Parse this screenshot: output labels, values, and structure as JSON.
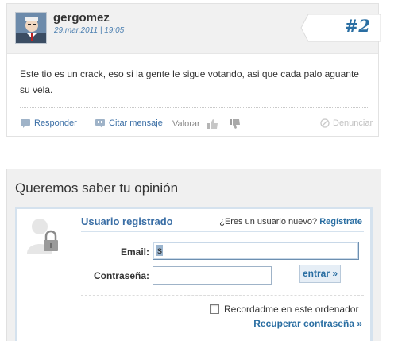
{
  "comment": {
    "username": "gergomez",
    "meta": "29.mar.2011 | 19:05",
    "post_number": "#2",
    "text": "Este tio es un crack, eso si la gente le sigue votando, asi que cada palo aguante su vela.",
    "actions": {
      "reply": "Responder",
      "quote": "Citar mensaje",
      "rate": "Valorar",
      "report": "Denunciar"
    }
  },
  "opinion": {
    "title": "Queremos saber tu opinión",
    "login": {
      "section_title": "Usuario registrado",
      "new_user_question": "¿Eres un usuario nuevo?",
      "register_link": "Regístrate",
      "email_label": "Email:",
      "email_value": "s",
      "password_label": "Contraseña:",
      "password_value": "",
      "submit_label": "entrar »",
      "remember_label": "Recordadme en este ordenador",
      "recover_link": "Recuperar contraseña »"
    }
  },
  "colors": {
    "link": "#3a6ea5",
    "accent": "#2a6ea2",
    "meta": "#4b7fb0",
    "panel_bg": "#f0f0f0",
    "box_border": "#d5e2ee"
  },
  "icons": [
    "avatar",
    "speech-bubble-icon",
    "quote-bubble-icon",
    "thumbs-up-icon",
    "thumbs-down-icon",
    "forbidden-icon",
    "user-lock-icon"
  ]
}
